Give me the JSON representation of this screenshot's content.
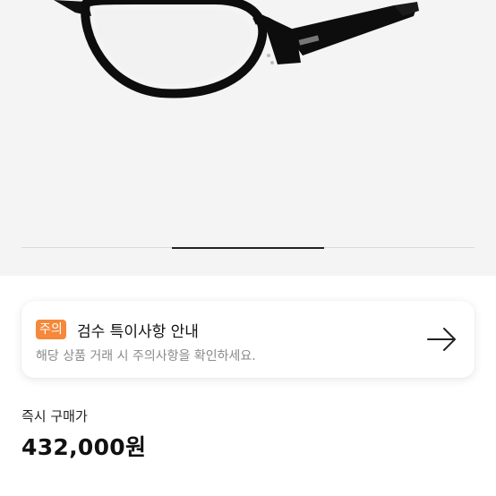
{
  "notice": {
    "badge": "주의",
    "title": "검수 특이사항 안내",
    "description": "해당 상품 거래 시 주의사항을 확인하세요.",
    "arrow_icon": "arrow-right-icon"
  },
  "price": {
    "label": "즉시 구매가",
    "value": "432,000원"
  },
  "carousel": {
    "current_slide_indicator": "arrow-right-icon",
    "product_image": "eyeglasses-product-image"
  },
  "colors": {
    "badge": "#f5883b",
    "hero_background": "#f4f4f4"
  }
}
